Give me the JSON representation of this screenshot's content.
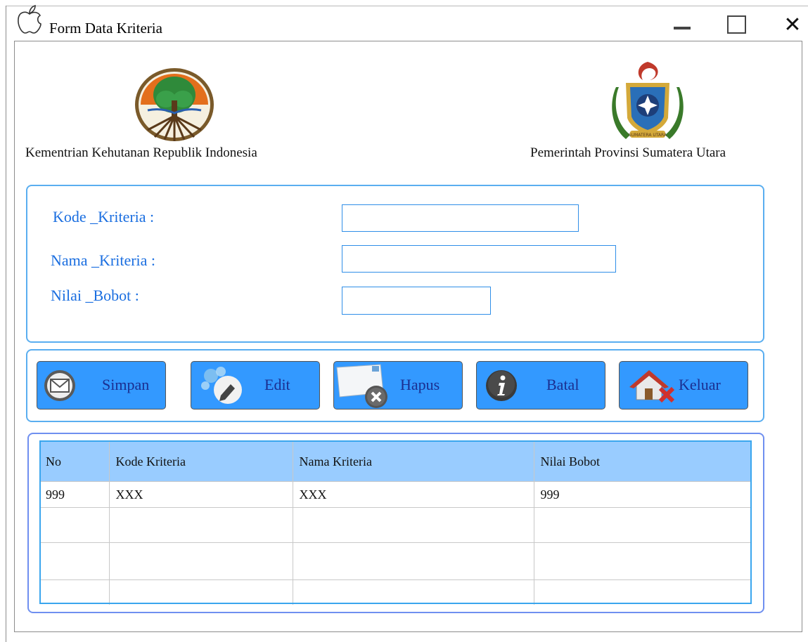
{
  "window": {
    "title": "Form Data Kriteria",
    "close_glyph": "✕"
  },
  "header": {
    "left_org": "Kementrian Kehutanan Republik Indonesia",
    "right_org": "Pemerintah Provinsi Sumatera Utara"
  },
  "form": {
    "kode_label": "Kode _Kriteria :",
    "nama_label": "Nama _Kriteria :",
    "nilai_label": "Nilai _Bobot :",
    "kode_value": "",
    "nama_value": "",
    "nilai_value": ""
  },
  "buttons": {
    "simpan": "Simpan",
    "edit": "Edit",
    "hapus": "Hapus",
    "batal": "Batal",
    "keluar": "Keluar"
  },
  "table": {
    "columns": [
      "No",
      "Kode Kriteria",
      "Nama Kriteria",
      "Nilai Bobot"
    ],
    "rows": [
      [
        "999",
        "XXX",
        "XXX",
        "999"
      ],
      [
        "",
        "",
        "",
        ""
      ],
      [
        "",
        "",
        "",
        ""
      ],
      [
        "",
        "",
        "",
        ""
      ]
    ]
  },
  "colors": {
    "accent": "#3399ff",
    "label_blue": "#1a6ee0",
    "table_header": "#99ccff",
    "panel_border": "#5aaef0"
  },
  "icons": {
    "app": "apple-outline-icon",
    "minimize": "minimize-icon",
    "maximize": "maximize-icon",
    "close": "close-icon",
    "simpan": "envelope-save-icon",
    "edit": "pencil-edit-icon",
    "hapus": "mail-delete-icon",
    "batal": "info-icon",
    "keluar": "house-exit-icon"
  }
}
